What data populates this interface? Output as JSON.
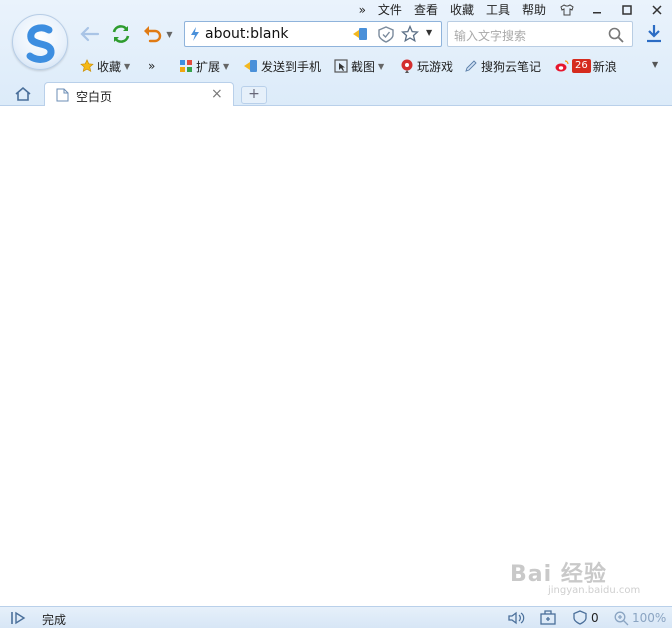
{
  "menu": {
    "more": "»",
    "file": "文件",
    "view": "查看",
    "favorites": "收藏",
    "tools": "工具",
    "help": "帮助"
  },
  "address": {
    "url": "about:blank"
  },
  "search": {
    "placeholder": "输入文字搜索"
  },
  "bookmarks": {
    "favorites": "收藏",
    "more": "»",
    "extensions": "扩展",
    "send_to_phone": "发送到手机",
    "screenshot": "截图",
    "games": "玩游戏",
    "cloud_notes": "搜狗云笔记",
    "weibo_badge": "26",
    "weibo": "新浪"
  },
  "tab": {
    "title": "空白页",
    "close": "×",
    "new": "+"
  },
  "status": {
    "text": "完成",
    "shield_count": "0",
    "zoom": "100%"
  },
  "watermark": {
    "brand": "Bai 经验",
    "sub": "jingyan.baidu.com"
  },
  "colors": {
    "accent": "#4a90d9",
    "refresh": "#2e9c2e",
    "undo": "#e07b14",
    "weibo": "#d52b1e"
  }
}
